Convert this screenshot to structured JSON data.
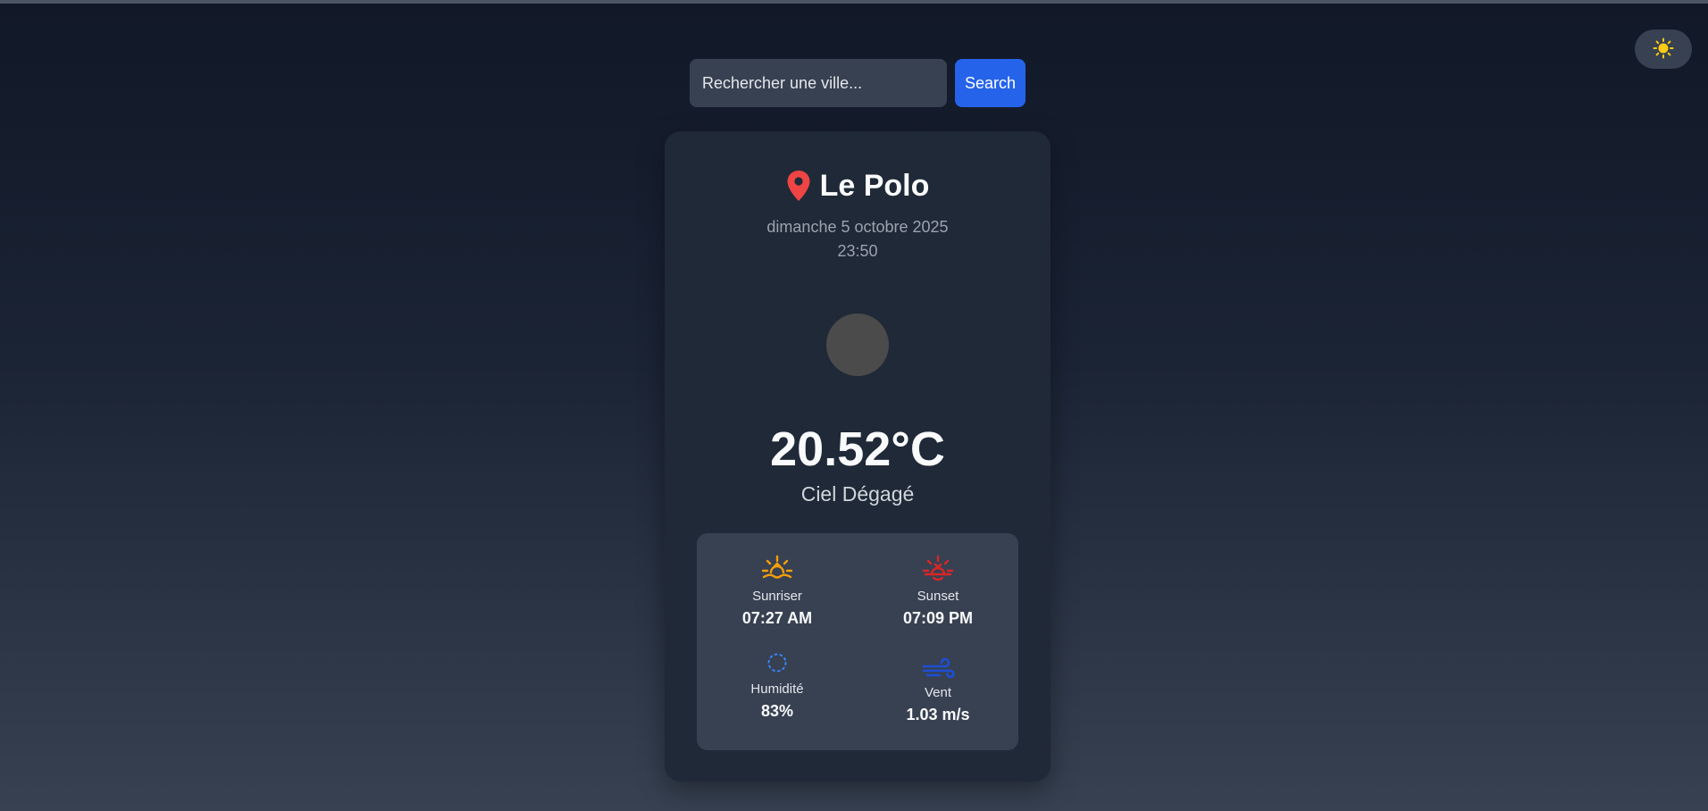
{
  "theme_toggle": {
    "icon": "sun-icon",
    "color": "#facc15"
  },
  "search": {
    "placeholder": "Rechercher une ville...",
    "button_label": "Search"
  },
  "location": {
    "city": "Le Polo",
    "icon": "map-pin-icon",
    "icon_color": "#ef4444"
  },
  "datetime": {
    "date": "dimanche 5 octobre 2025",
    "time": "23:50"
  },
  "weather": {
    "temperature": "20.52°C",
    "condition": "Ciel Dégagé"
  },
  "details": {
    "sunrise": {
      "label": "Sunriser",
      "value": "07:27 AM",
      "icon": "sunrise-icon",
      "color": "#f59e0b"
    },
    "sunset": {
      "label": "Sunset",
      "value": "07:09 PM",
      "icon": "sunset-icon",
      "color": "#dc2626"
    },
    "humidity": {
      "label": "Humidité",
      "value": "83%",
      "icon": "humidity-icon",
      "color": "#3b82f6"
    },
    "wind": {
      "label": "Vent",
      "value": "1.03 m/s",
      "icon": "wind-icon",
      "color": "#1d4ed8"
    }
  },
  "colors": {
    "accent": "#2563eb",
    "card": "#1f2937",
    "panel": "#374151"
  }
}
